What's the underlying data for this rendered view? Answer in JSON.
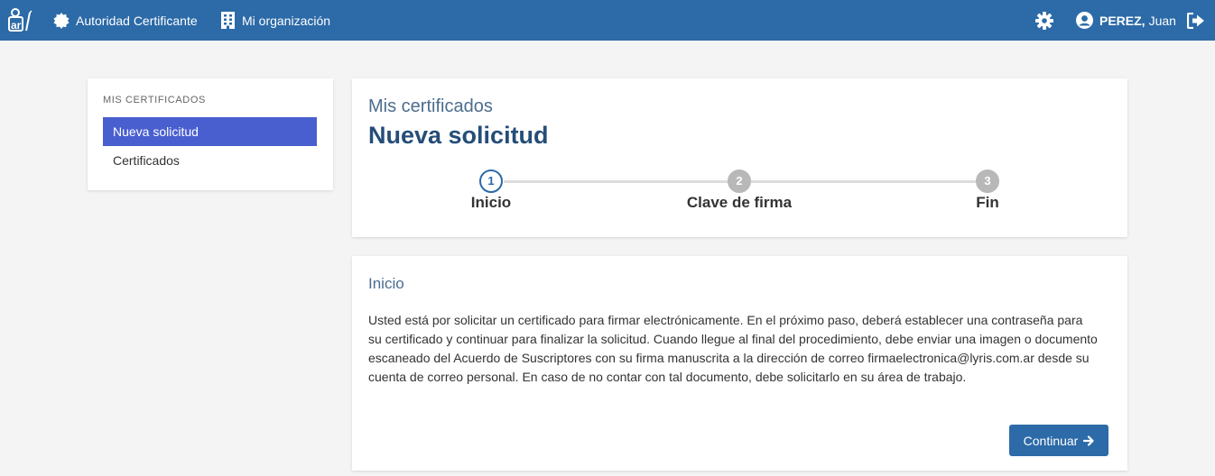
{
  "header": {
    "logo": "ar",
    "nav_ca": "Autoridad Certificante",
    "nav_org": "Mi organización",
    "user_surname": "PEREZ,",
    "user_name": "Juan",
    "icons": {
      "ca": "badge-icon",
      "org": "building-icon",
      "settings": "gear-icon",
      "user": "user-circle-icon",
      "logout": "sign-out-icon"
    },
    "color": "#2c6aa8"
  },
  "sidebar": {
    "heading": "MIS CERTIFICADOS",
    "items": [
      {
        "label": "Nueva solicitud",
        "active": true
      },
      {
        "label": "Certificados",
        "active": false
      }
    ],
    "active_color": "#4a5fcf"
  },
  "page": {
    "breadcrumb": "Mis certificados",
    "title": "Nueva solicitud"
  },
  "stepper": {
    "steps": [
      {
        "number": "1",
        "label": "Inicio",
        "state": "current"
      },
      {
        "number": "2",
        "label": "Clave de firma",
        "state": "pending"
      },
      {
        "number": "3",
        "label": "Fin",
        "state": "pending"
      }
    ]
  },
  "content": {
    "section_title": "Inicio",
    "paragraph": "Usted está por solicitar un certificado para firmar electrónicamente. En el próximo paso, deberá establecer una contraseña para su certificado y continuar para finalizar la solicitud. Cuando llegue al final del procedimiento, debe enviar una imagen o documento escaneado del Acuerdo de Suscriptores con su firma manuscrita a la dirección de correo firmaelectronica@lyris.com.ar desde su cuenta de correo personal. En caso de no contar con tal documento, debe solicitarlo en su área de trabajo.",
    "continue_label": "Continuar",
    "continue_icon": "arrow-right-icon"
  }
}
